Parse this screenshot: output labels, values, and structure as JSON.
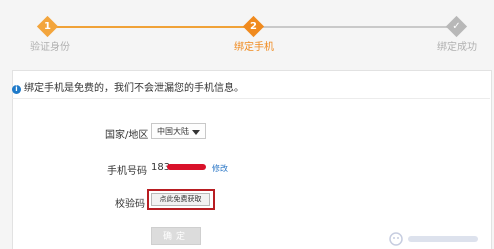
{
  "steps": [
    {
      "num": "1",
      "label": "验证身份",
      "state": "done"
    },
    {
      "num": "2",
      "label": "绑定手机",
      "state": "active"
    },
    {
      "num": "",
      "label": "绑定成功",
      "state": "pending",
      "icon": "check-icon"
    }
  ],
  "notice": {
    "text": "绑定手机是免费的，我们不会泄漏您的手机信息。",
    "icon": "info-icon"
  },
  "form": {
    "region_label": "国家/地区",
    "region_value": "中国大陆",
    "phone_label": "手机号码",
    "phone_prefix": "183",
    "modify_label": "修改",
    "code_label": "校验码",
    "get_code_button": "点此免费获取",
    "confirm_button": "确定"
  },
  "colors": {
    "accent": "#f08a1e",
    "done": "#f3a53c",
    "pending": "#b8b8b8",
    "link": "#2a76c6",
    "highlight": "#b81d22"
  }
}
